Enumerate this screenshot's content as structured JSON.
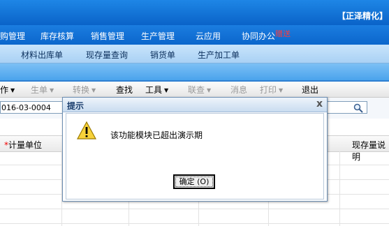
{
  "app": {
    "title": "【正泽精化】"
  },
  "menu": [
    "购管理",
    "库存核算",
    "销售管理",
    "生产管理",
    "云应用",
    "协同办公"
  ],
  "menu_tag": "赠送",
  "submenu": [
    "材料出库单",
    "现存量查询",
    "销货单",
    "生产加工单"
  ],
  "toolbar": {
    "first": "作",
    "generate": "生单",
    "convert": "转换",
    "find": "查找",
    "tools": "工具",
    "linked": "联查",
    "message": "消息",
    "print": "打印",
    "exit": "退出"
  },
  "form": {
    "doc_number": "016-03-0004"
  },
  "grid": {
    "col_unit": "计量单位",
    "col_stock": "现存量说明",
    "required_mark": "*"
  },
  "dialog": {
    "title": "提示",
    "close": "x",
    "message": "该功能模块已超出演示期",
    "ok_label": "确定 (O)"
  }
}
